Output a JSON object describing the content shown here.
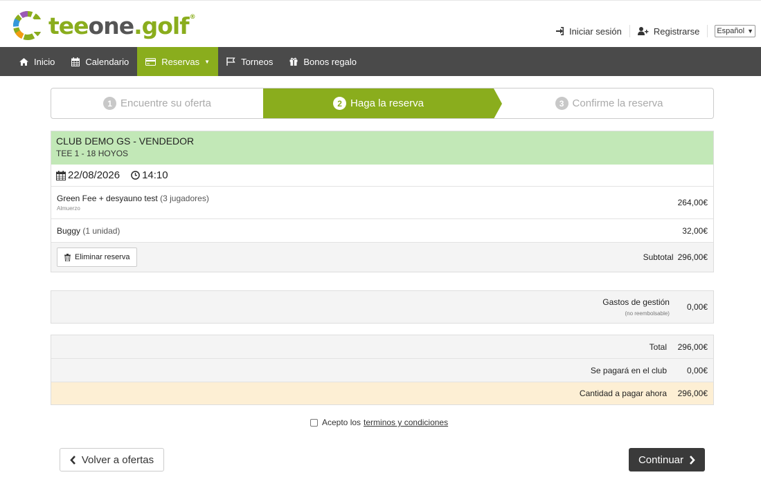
{
  "header": {
    "logo_text_1": "tee",
    "logo_text_2": "one",
    "logo_text_3": ".golf",
    "logo_reg": "®",
    "login_label": "Iniciar sesión",
    "register_label": "Registrarse",
    "language": "Español"
  },
  "nav": {
    "items": [
      {
        "label": "Inicio",
        "icon": "home-icon"
      },
      {
        "label": "Calendario",
        "icon": "calendar-icon"
      },
      {
        "label": "Reservas",
        "icon": "card-icon"
      },
      {
        "label": "Torneos",
        "icon": "flag-icon"
      },
      {
        "label": "Bonos regalo",
        "icon": "gift-icon"
      }
    ]
  },
  "steps": [
    {
      "num": "1",
      "label": "Encuentre su oferta"
    },
    {
      "num": "2",
      "label": "Haga la reserva"
    },
    {
      "num": "3",
      "label": "Confirme la reserva"
    }
  ],
  "booking": {
    "club_name": "CLUB DEMO GS - VENDEDOR",
    "tee": "TEE 1 - 18 HOYOS",
    "date": "22/08/2026",
    "time": "14:10",
    "lines": [
      {
        "name": "Green Fee + desyauno test",
        "qty": "(3 jugadores)",
        "sub": "Almuerzo",
        "price": "264,00€"
      },
      {
        "name": "Buggy",
        "qty": "(1 unidad)",
        "price": "32,00€"
      }
    ],
    "delete_label": "Eliminar reserva",
    "subtotal_label": "Subtotal",
    "subtotal_value": "296,00€"
  },
  "fees": {
    "label": "Gastos de gestión",
    "note": "(no reembolsable)",
    "value": "0,00€"
  },
  "totals": {
    "total_label": "Total",
    "total_value": "296,00€",
    "club_label": "Se pagará en el club",
    "club_value": "0,00€",
    "now_label": "Cantidad a pagar ahora",
    "now_value": "296,00€"
  },
  "terms": {
    "prefix": "Acepto los",
    "link": "terminos y condiciones"
  },
  "actions": {
    "back_label": "Volver a ofertas",
    "continue_label": "Continuar"
  },
  "colors": {
    "brand_green": "#8aad1d",
    "nav_bg": "#4a4a4a",
    "club_header_bg": "#c2e8b7",
    "pay_now_bg": "#fdefd4"
  }
}
